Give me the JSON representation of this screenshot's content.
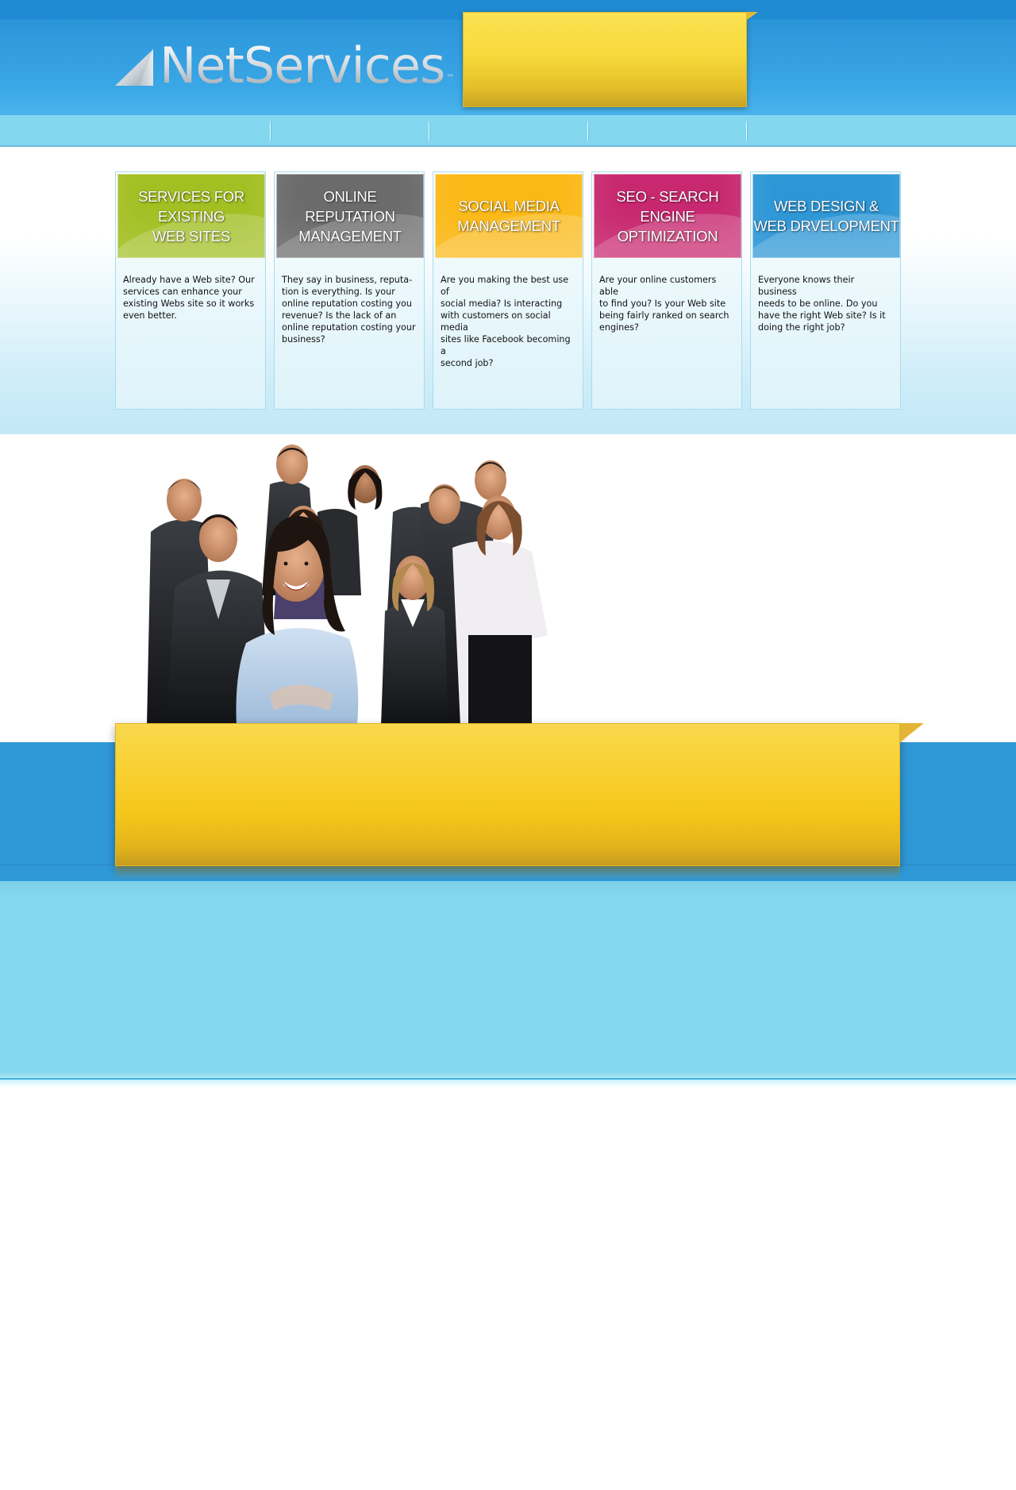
{
  "brand": {
    "name": "NetServices",
    "trademark": "™"
  },
  "nav": {
    "items": [
      "",
      "",
      "",
      "",
      ""
    ]
  },
  "services": [
    {
      "title": "SERVICES FOR\nEXISTING\nWEB SITES",
      "color": "#a3bf22",
      "description": "Already have a Web site? Our\nservices can enhance your\nexisting Webs site so it works\neven better."
    },
    {
      "title": "ONLINE\nREPUTATION\nMANAGEMENT",
      "color": "#6b6b6b",
      "description": "They say in business, reputa-\ntion is everything. Is your\nonline reputation costing you\nrevenue? Is the lack of an\nonline reputation costing your\nbusiness?"
    },
    {
      "title": "SOCIAL MEDIA\nMANAGEMENT",
      "color": "#fbb917",
      "description": "Are you making the best use of\nsocial media? Is interacting\nwith customers on social media\nsites like Facebook becoming a\nsecond job?"
    },
    {
      "title": "SEO - SEARCH\nENGINE\nOPTIMIZATION",
      "color": "#c8286f",
      "description": "Are your online customers able\nto find you? Is your Web site\nbeing fairly ranked on search\nengines?"
    },
    {
      "title": "WEB DESIGN &\nWEB DRVELOPMENT",
      "color": "#2c96d6",
      "description": "Everyone knows their business\nneeds to be online. Do you\nhave the right Web site? Is it\ndoing the right job?"
    }
  ],
  "colors": {
    "header_blue": "#2b95d9",
    "nav_cyan": "#83d8ef",
    "note_yellow": "#f9d134",
    "band_blue": "#2f98d6"
  }
}
